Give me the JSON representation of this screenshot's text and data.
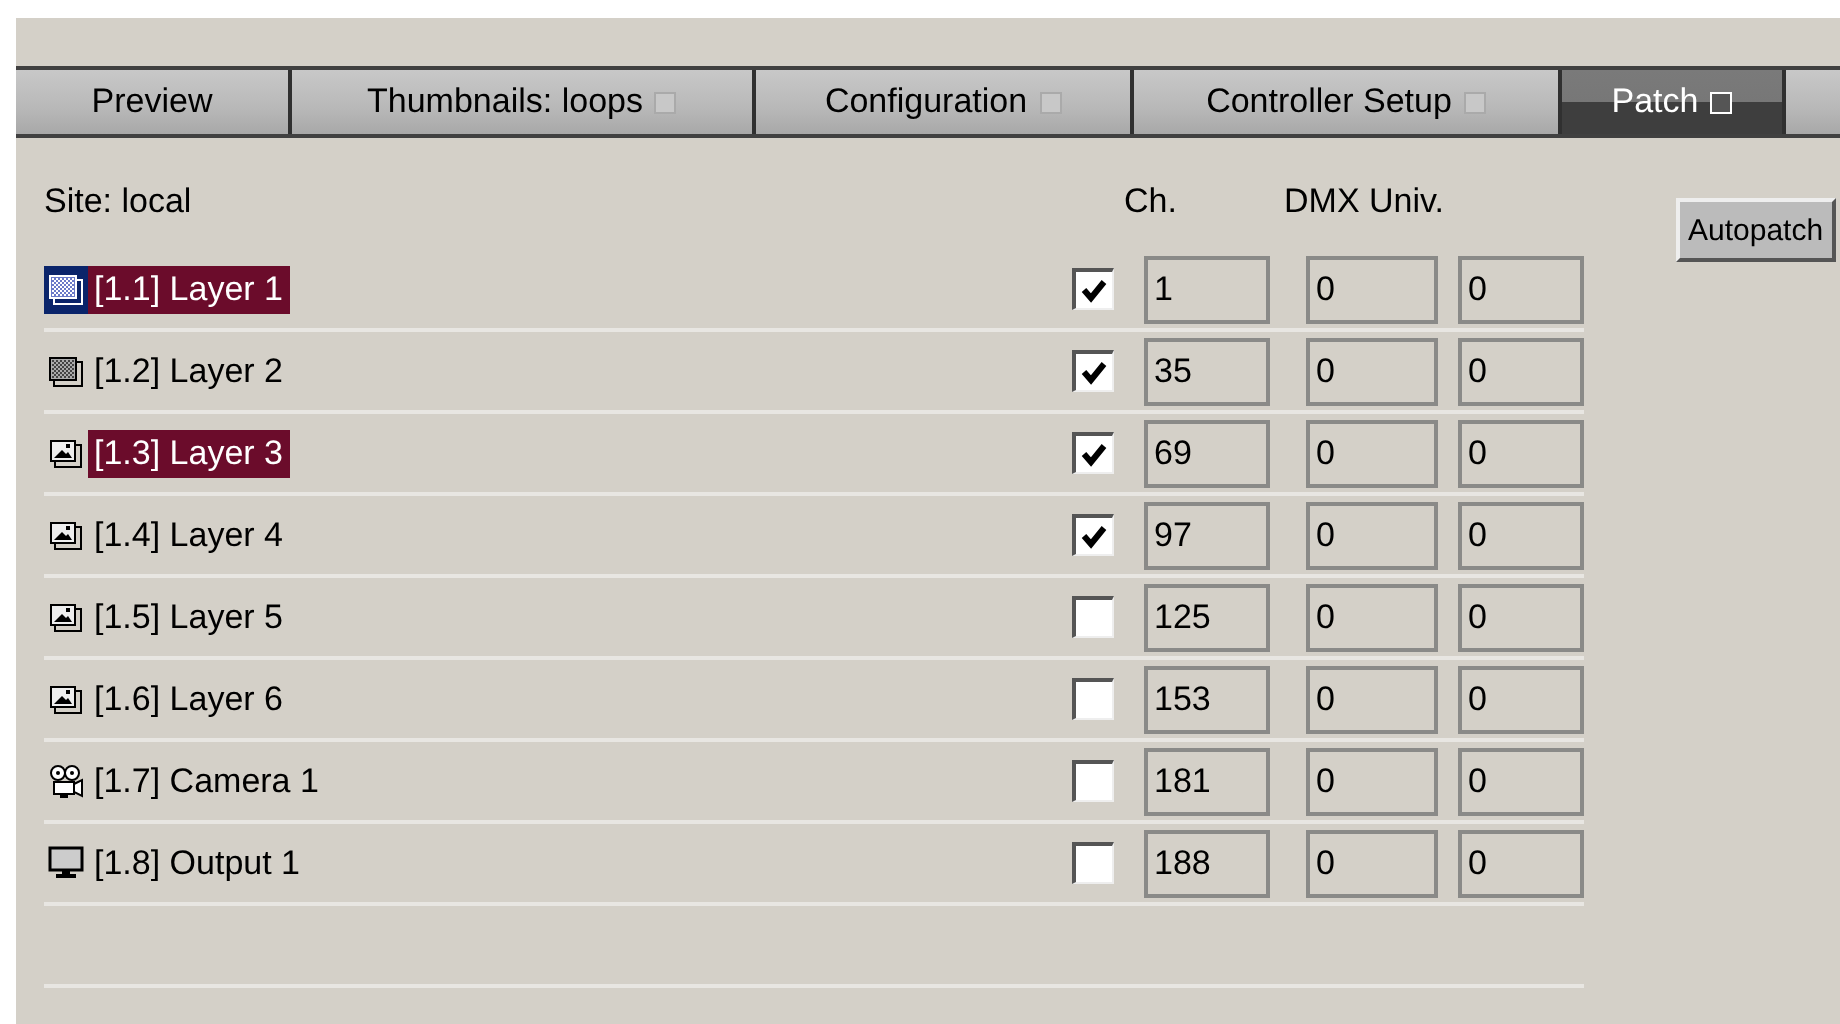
{
  "tabs": [
    {
      "label": "Preview",
      "selected": false,
      "closable": false
    },
    {
      "label": "Thumbnails: loops",
      "selected": false,
      "closable": true
    },
    {
      "label": "Configuration",
      "selected": false,
      "closable": true
    },
    {
      "label": "Controller Setup",
      "selected": false,
      "closable": true
    },
    {
      "label": "Patch",
      "selected": true,
      "closable": true
    }
  ],
  "site": "Site: local",
  "columns": {
    "channel": "Ch.",
    "dmx": "DMX Univ."
  },
  "autopatch_button": "Autopatch",
  "rows": [
    {
      "kind": "pattern",
      "name": "[1.1] Layer 1",
      "selected": true,
      "focused": true,
      "checked": true,
      "channel": "1",
      "dmx_1": "0",
      "dmx_2": "0"
    },
    {
      "kind": "pattern",
      "name": "[1.2] Layer 2",
      "selected": false,
      "focused": false,
      "checked": true,
      "channel": "35",
      "dmx_1": "0",
      "dmx_2": "0"
    },
    {
      "kind": "image",
      "name": "[1.3] Layer 3",
      "selected": true,
      "focused": false,
      "checked": true,
      "channel": "69",
      "dmx_1": "0",
      "dmx_2": "0"
    },
    {
      "kind": "image",
      "name": "[1.4] Layer 4",
      "selected": false,
      "focused": false,
      "checked": true,
      "channel": "97",
      "dmx_1": "0",
      "dmx_2": "0"
    },
    {
      "kind": "image",
      "name": "[1.5] Layer 5",
      "selected": false,
      "focused": false,
      "checked": false,
      "channel": "125",
      "dmx_1": "0",
      "dmx_2": "0"
    },
    {
      "kind": "image",
      "name": "[1.6] Layer 6",
      "selected": false,
      "focused": false,
      "checked": false,
      "channel": "153",
      "dmx_1": "0",
      "dmx_2": "0"
    },
    {
      "kind": "camera",
      "name": "[1.7] Camera 1",
      "selected": false,
      "focused": false,
      "checked": false,
      "channel": "181",
      "dmx_1": "0",
      "dmx_2": "0"
    },
    {
      "kind": "monitor",
      "name": "[1.8] Output 1",
      "selected": false,
      "focused": false,
      "checked": false,
      "channel": "188",
      "dmx_1": "0",
      "dmx_2": "0"
    }
  ]
}
